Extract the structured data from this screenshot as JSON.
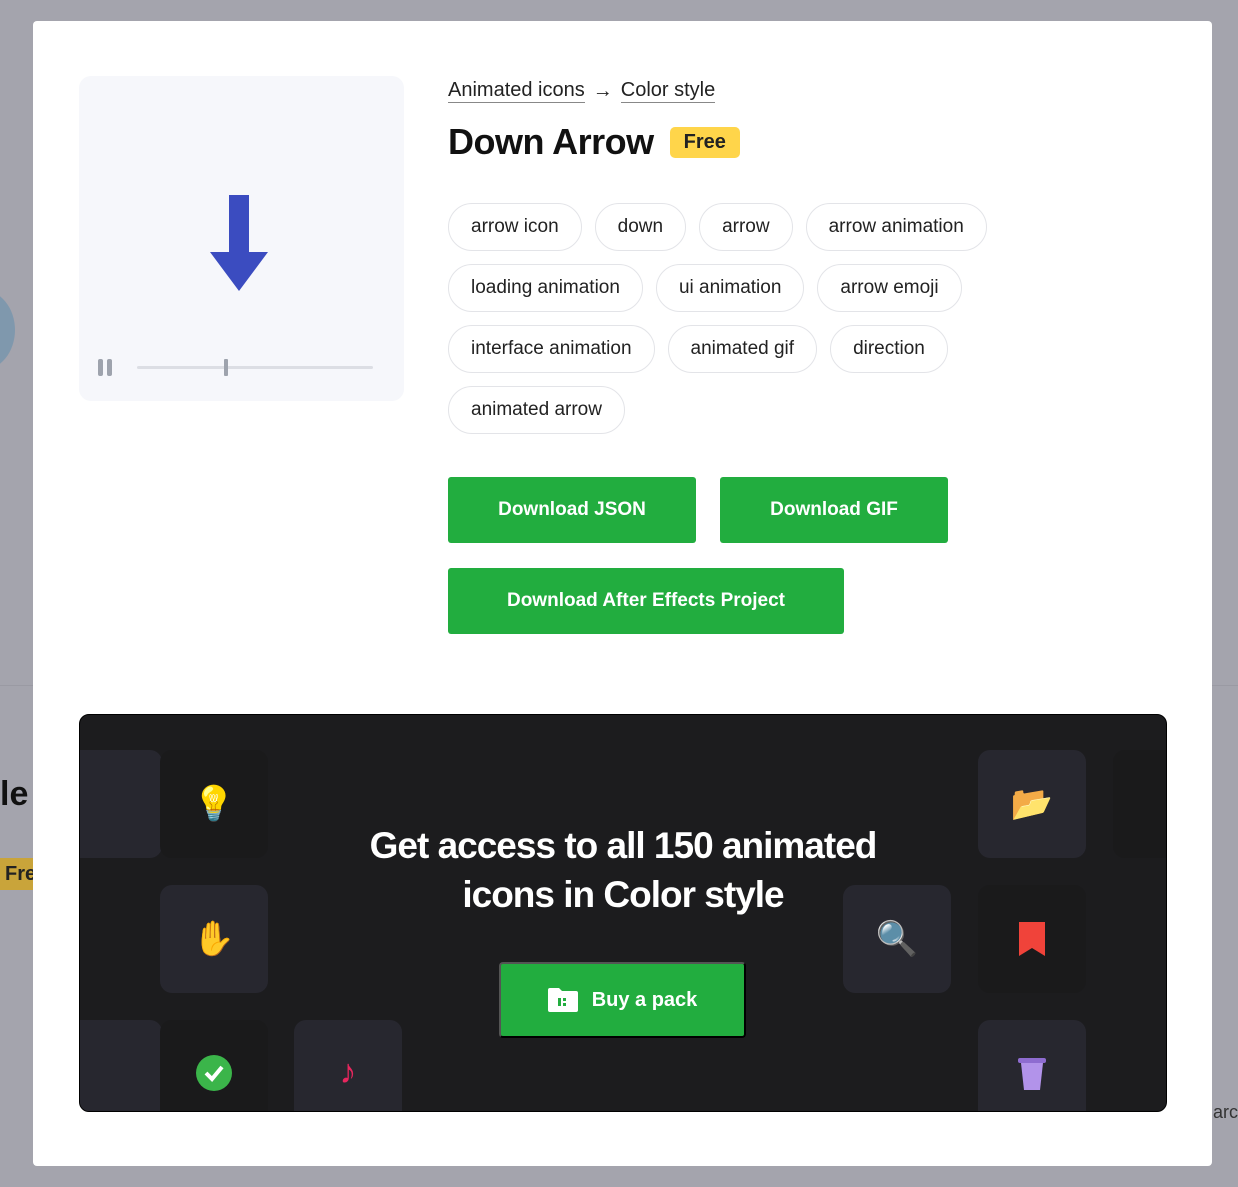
{
  "breadcrumb": {
    "parent": "Animated icons",
    "separator": "→",
    "current": "Color style"
  },
  "title": "Down Arrow",
  "badge": "Free",
  "player": {
    "state": "paused",
    "progress_percent": 37,
    "arrow_color": "#3b4cc0"
  },
  "tags": [
    "arrow icon",
    "down",
    "arrow",
    "arrow animation",
    "loading animation",
    "ui animation",
    "arrow emoji",
    "interface animation",
    "animated gif",
    "direction",
    "animated arrow"
  ],
  "buttons": {
    "json": "Download JSON",
    "gif": "Download GIF",
    "ae": "Download After Effects Project"
  },
  "banner": {
    "line1": "Get access to all 150 animated",
    "line2": "icons in Color style",
    "cta": "Buy a pack"
  },
  "background": {
    "partial_title": "le",
    "partial_badge": "Fre",
    "partial_text": "arc"
  },
  "colors": {
    "accent": "#22ad3f",
    "badge": "#ffd54a",
    "banner_bg": "#1c1c1e"
  }
}
